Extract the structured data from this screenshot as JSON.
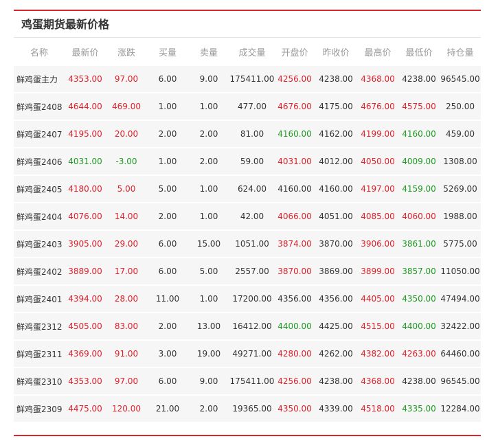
{
  "panel": {
    "title": "鸡蛋期货最新价格"
  },
  "colors": {
    "accent_rule": "#d9262c",
    "rise": "#e0202a",
    "fall": "#1e9a22",
    "flat": "#333333",
    "header_text": "#999999",
    "row_background": "#f6f6f6"
  },
  "table": {
    "columns": [
      {
        "key": "name",
        "label": "名称"
      },
      {
        "key": "latest",
        "label": "最新价"
      },
      {
        "key": "change",
        "label": "涨跌"
      },
      {
        "key": "bid_vol",
        "label": "买量"
      },
      {
        "key": "ask_vol",
        "label": "卖量"
      },
      {
        "key": "volume",
        "label": "成交量"
      },
      {
        "key": "open",
        "label": "开盘价"
      },
      {
        "key": "prev_close",
        "label": "昨收价"
      },
      {
        "key": "high",
        "label": "最高价"
      },
      {
        "key": "low",
        "label": "最低价"
      },
      {
        "key": "open_interest",
        "label": "持仓量"
      }
    ],
    "rows": [
      {
        "cells": [
          "鲜鸡蛋主力",
          "4353.00",
          "97.00",
          "6.00",
          "9.00",
          "175411.00",
          "4256.00",
          "4238.00",
          "4368.00",
          "4238.00",
          "96545.00"
        ],
        "tones": [
          "flat",
          "up",
          "up",
          "flat",
          "flat",
          "flat",
          "up",
          "flat",
          "up",
          "flat",
          "flat"
        ]
      },
      {
        "cells": [
          "鲜鸡蛋2408",
          "4644.00",
          "469.00",
          "1.00",
          "1.00",
          "477.00",
          "4676.00",
          "4175.00",
          "4676.00",
          "4575.00",
          "250.00"
        ],
        "tones": [
          "flat",
          "up",
          "up",
          "flat",
          "flat",
          "flat",
          "up",
          "flat",
          "up",
          "up",
          "flat"
        ]
      },
      {
        "cells": [
          "鲜鸡蛋2407",
          "4195.00",
          "20.00",
          "2.00",
          "2.00",
          "81.00",
          "4160.00",
          "4162.00",
          "4199.00",
          "4160.00",
          "459.00"
        ],
        "tones": [
          "flat",
          "up",
          "up",
          "flat",
          "flat",
          "flat",
          "down",
          "flat",
          "up",
          "down",
          "flat"
        ]
      },
      {
        "cells": [
          "鲜鸡蛋2406",
          "4031.00",
          "-3.00",
          "1.00",
          "2.00",
          "59.00",
          "4031.00",
          "4012.00",
          "4050.00",
          "4009.00",
          "1308.00"
        ],
        "tones": [
          "flat",
          "down",
          "down",
          "flat",
          "flat",
          "flat",
          "up",
          "flat",
          "up",
          "down",
          "flat"
        ]
      },
      {
        "cells": [
          "鲜鸡蛋2405",
          "4180.00",
          "5.00",
          "5.00",
          "1.00",
          "624.00",
          "4160.00",
          "4160.00",
          "4197.00",
          "4159.00",
          "5269.00"
        ],
        "tones": [
          "flat",
          "up",
          "up",
          "flat",
          "flat",
          "flat",
          "flat",
          "flat",
          "up",
          "down",
          "flat"
        ]
      },
      {
        "cells": [
          "鲜鸡蛋2404",
          "4076.00",
          "14.00",
          "2.00",
          "1.00",
          "42.00",
          "4066.00",
          "4051.00",
          "4085.00",
          "4060.00",
          "1988.00"
        ],
        "tones": [
          "flat",
          "up",
          "up",
          "flat",
          "flat",
          "flat",
          "up",
          "flat",
          "up",
          "up",
          "flat"
        ]
      },
      {
        "cells": [
          "鲜鸡蛋2403",
          "3905.00",
          "29.00",
          "6.00",
          "15.00",
          "1051.00",
          "3874.00",
          "3870.00",
          "3906.00",
          "3861.00",
          "5775.00"
        ],
        "tones": [
          "flat",
          "up",
          "up",
          "flat",
          "flat",
          "flat",
          "up",
          "flat",
          "up",
          "down",
          "flat"
        ]
      },
      {
        "cells": [
          "鲜鸡蛋2402",
          "3889.00",
          "17.00",
          "6.00",
          "5.00",
          "2557.00",
          "3870.00",
          "3869.00",
          "3899.00",
          "3857.00",
          "11050.00"
        ],
        "tones": [
          "flat",
          "up",
          "up",
          "flat",
          "flat",
          "flat",
          "up",
          "flat",
          "up",
          "down",
          "flat"
        ]
      },
      {
        "cells": [
          "鲜鸡蛋2401",
          "4394.00",
          "28.00",
          "11.00",
          "1.00",
          "17200.00",
          "4356.00",
          "4356.00",
          "4405.00",
          "4350.00",
          "47494.00"
        ],
        "tones": [
          "flat",
          "up",
          "up",
          "flat",
          "flat",
          "flat",
          "flat",
          "flat",
          "up",
          "down",
          "flat"
        ]
      },
      {
        "cells": [
          "鲜鸡蛋2312",
          "4505.00",
          "83.00",
          "2.00",
          "13.00",
          "16412.00",
          "4400.00",
          "4425.00",
          "4515.00",
          "4400.00",
          "32422.00"
        ],
        "tones": [
          "flat",
          "up",
          "up",
          "flat",
          "flat",
          "flat",
          "down",
          "flat",
          "up",
          "down",
          "flat"
        ]
      },
      {
        "cells": [
          "鲜鸡蛋2311",
          "4369.00",
          "91.00",
          "3.00",
          "19.00",
          "49271.00",
          "4280.00",
          "4262.00",
          "4382.00",
          "4263.00",
          "64460.00"
        ],
        "tones": [
          "flat",
          "up",
          "up",
          "flat",
          "flat",
          "flat",
          "up",
          "flat",
          "up",
          "up",
          "flat"
        ]
      },
      {
        "cells": [
          "鲜鸡蛋2310",
          "4353.00",
          "97.00",
          "6.00",
          "9.00",
          "175411.00",
          "4256.00",
          "4238.00",
          "4368.00",
          "4238.00",
          "96545.00"
        ],
        "tones": [
          "flat",
          "up",
          "up",
          "flat",
          "flat",
          "flat",
          "up",
          "flat",
          "up",
          "flat",
          "flat"
        ]
      },
      {
        "cells": [
          "鲜鸡蛋2309",
          "4475.00",
          "120.00",
          "21.00",
          "2.00",
          "19365.00",
          "4350.00",
          "4339.00",
          "4518.00",
          "4335.00",
          "12284.00"
        ],
        "tones": [
          "flat",
          "up",
          "up",
          "flat",
          "flat",
          "flat",
          "up",
          "flat",
          "up",
          "down",
          "flat"
        ]
      }
    ]
  }
}
